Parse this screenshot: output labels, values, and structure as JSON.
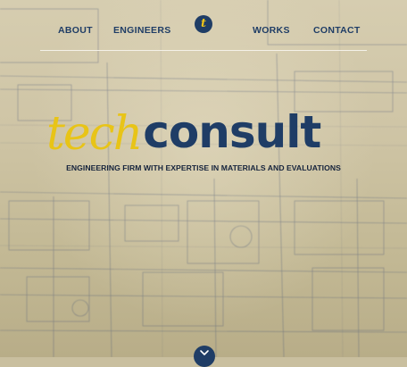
{
  "nav": {
    "items": [
      {
        "label": "ABOUT"
      },
      {
        "label": "ENGINEERS"
      },
      {
        "label": "WORKS"
      },
      {
        "label": "CONTACT"
      }
    ],
    "logo_letter": "t"
  },
  "hero": {
    "brand_part1": "tech",
    "brand_part2": "consult",
    "tagline": "ENGINEERING FIRM WITH EXPERTISE IN MATERIALS AND EVALUATIONS"
  },
  "colors": {
    "navy": "#1f3d66",
    "gold": "#e8c417",
    "paper": "#cfc5a6"
  },
  "icons": {
    "logo": "t-logo-icon",
    "scroll": "chevron-down-icon"
  }
}
